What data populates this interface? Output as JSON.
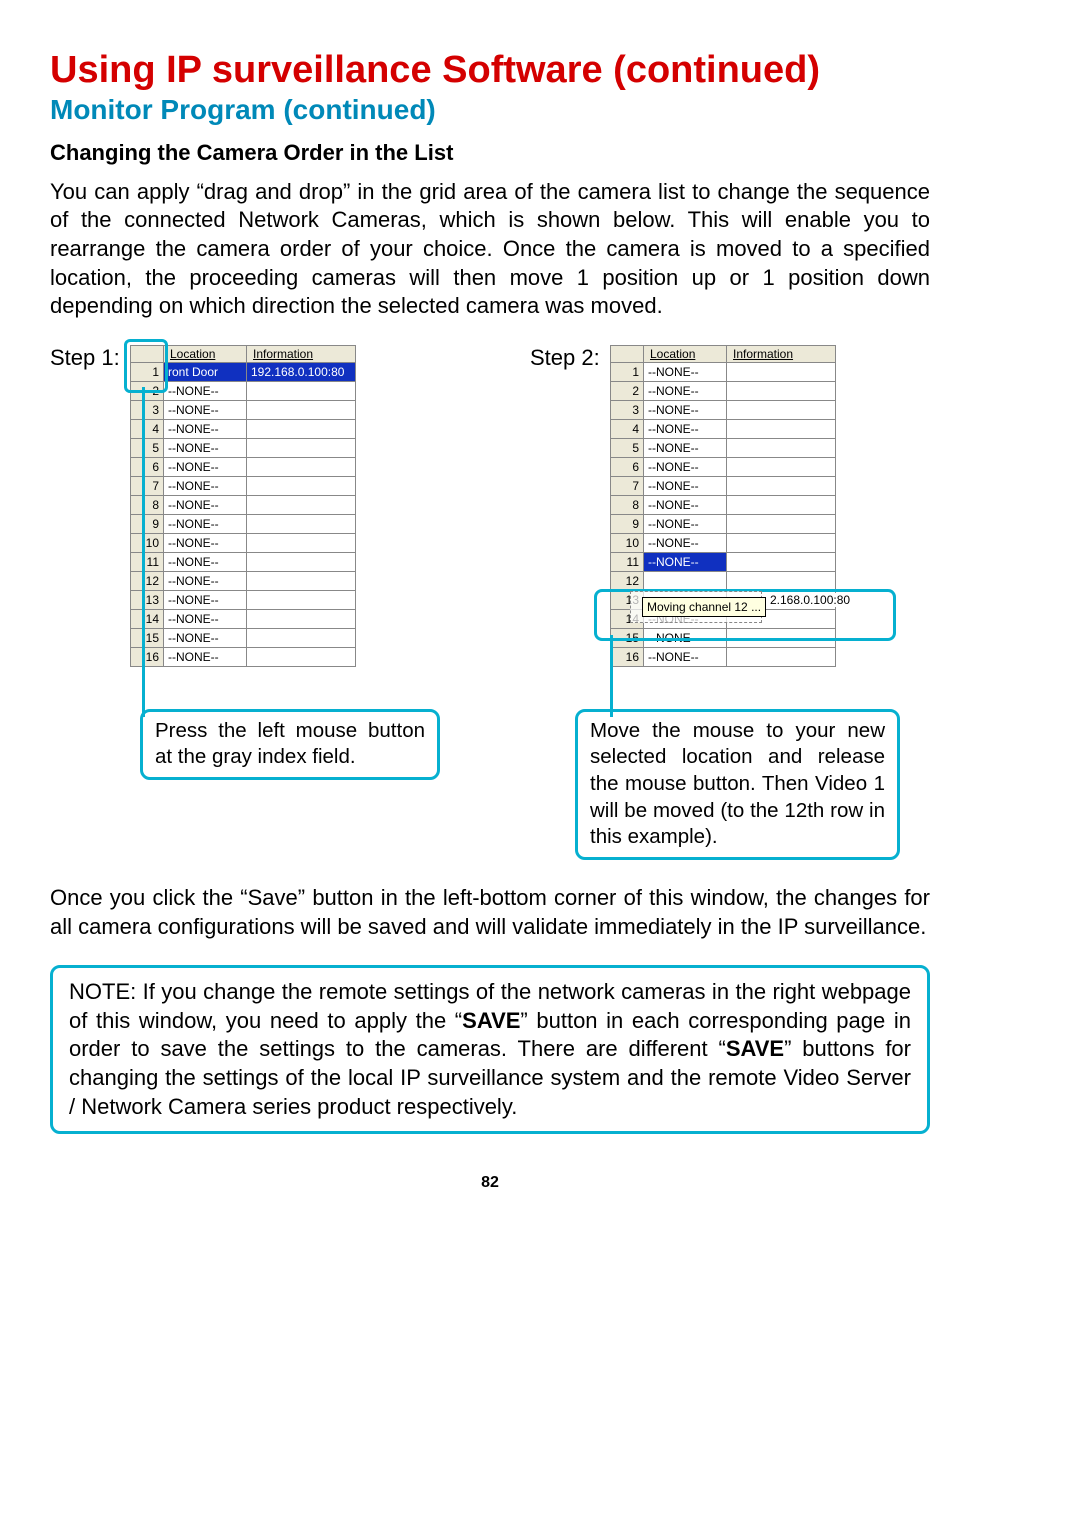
{
  "title": "Using IP surveillance Software (continued)",
  "subtitle": "Monitor  Program  (continued)",
  "section_head": "Changing the Camera Order in the List",
  "intro": "You can apply “drag and drop” in the grid area of the camera list to change the sequence of the connected Network Cameras, which is shown below. This will enable you to rearrange the camera order of your choice. Once the camera is moved to a specified location, the proceeding cameras will then move 1 position up or 1 position down depending on which direction the selected camera was moved.",
  "step1": {
    "label": "Step 1:",
    "headers": {
      "idx": "",
      "loc": "Location",
      "info": "Information"
    },
    "rows": [
      {
        "n": "1",
        "loc": "ront Door",
        "info": "192.168.0.100:80",
        "sel": true
      },
      {
        "n": "2",
        "loc": "--NONE--",
        "info": ""
      },
      {
        "n": "3",
        "loc": "--NONE--",
        "info": ""
      },
      {
        "n": "4",
        "loc": "--NONE--",
        "info": ""
      },
      {
        "n": "5",
        "loc": "--NONE--",
        "info": ""
      },
      {
        "n": "6",
        "loc": "--NONE--",
        "info": ""
      },
      {
        "n": "7",
        "loc": "--NONE--",
        "info": ""
      },
      {
        "n": "8",
        "loc": "--NONE--",
        "info": ""
      },
      {
        "n": "9",
        "loc": "--NONE--",
        "info": ""
      },
      {
        "n": "10",
        "loc": "--NONE--",
        "info": ""
      },
      {
        "n": "11",
        "loc": "--NONE--",
        "info": ""
      },
      {
        "n": "12",
        "loc": "--NONE--",
        "info": ""
      },
      {
        "n": "13",
        "loc": "--NONE--",
        "info": ""
      },
      {
        "n": "14",
        "loc": "--NONE--",
        "info": ""
      },
      {
        "n": "15",
        "loc": "--NONE--",
        "info": ""
      },
      {
        "n": "16",
        "loc": "--NONE--",
        "info": ""
      }
    ],
    "caption": "Press the left mouse button at the gray index field."
  },
  "step2": {
    "label": "Step 2:",
    "headers": {
      "idx": "",
      "loc": "Location",
      "info": "Information"
    },
    "rows": [
      {
        "n": "1",
        "loc": "--NONE--",
        "info": ""
      },
      {
        "n": "2",
        "loc": "--NONE--",
        "info": ""
      },
      {
        "n": "3",
        "loc": "--NONE--",
        "info": ""
      },
      {
        "n": "4",
        "loc": "--NONE--",
        "info": ""
      },
      {
        "n": "5",
        "loc": "--NONE--",
        "info": ""
      },
      {
        "n": "6",
        "loc": "--NONE--",
        "info": ""
      },
      {
        "n": "7",
        "loc": "--NONE--",
        "info": ""
      },
      {
        "n": "8",
        "loc": "--NONE--",
        "info": ""
      },
      {
        "n": "9",
        "loc": "--NONE--",
        "info": ""
      },
      {
        "n": "10",
        "loc": "--NONE--",
        "info": ""
      },
      {
        "n": "11",
        "loc": "--NONE--",
        "info": "",
        "partsel": true
      },
      {
        "n": "12",
        "loc": "",
        "info": ""
      },
      {
        "n": "13",
        "loc": "",
        "info": ""
      },
      {
        "n": "14",
        "loc": "--NONE--",
        "info": ""
      },
      {
        "n": "15",
        "loc": "--NONE--",
        "info": ""
      },
      {
        "n": "16",
        "loc": "--NONE--",
        "info": ""
      }
    ],
    "drag_tooltip": "Moving channel 12 ...",
    "ghost_ip": "2.168.0.100:80",
    "caption": "Move the mouse to your new selected location and release the mouse button. Then Video 1 will be moved (to the 12th row in this example)."
  },
  "para2": "Once you click the “Save” button in the left-bottom corner of this window, the changes for all camera configurations will be saved and will validate immediately in the IP surveillance.",
  "note": {
    "pre": "NOTE: If you change the remote settings of the network cameras in the right webpage of this window, you need to apply the “",
    "b1": "SAVE",
    "mid": "” button in each corresponding page in order to save the settings to the cameras. There are different “",
    "b2": "SAVE",
    "post": "” buttons for changing the settings of the local IP surveillance system and the remote Video Server / Network Camera series product respectively."
  },
  "page": "82"
}
